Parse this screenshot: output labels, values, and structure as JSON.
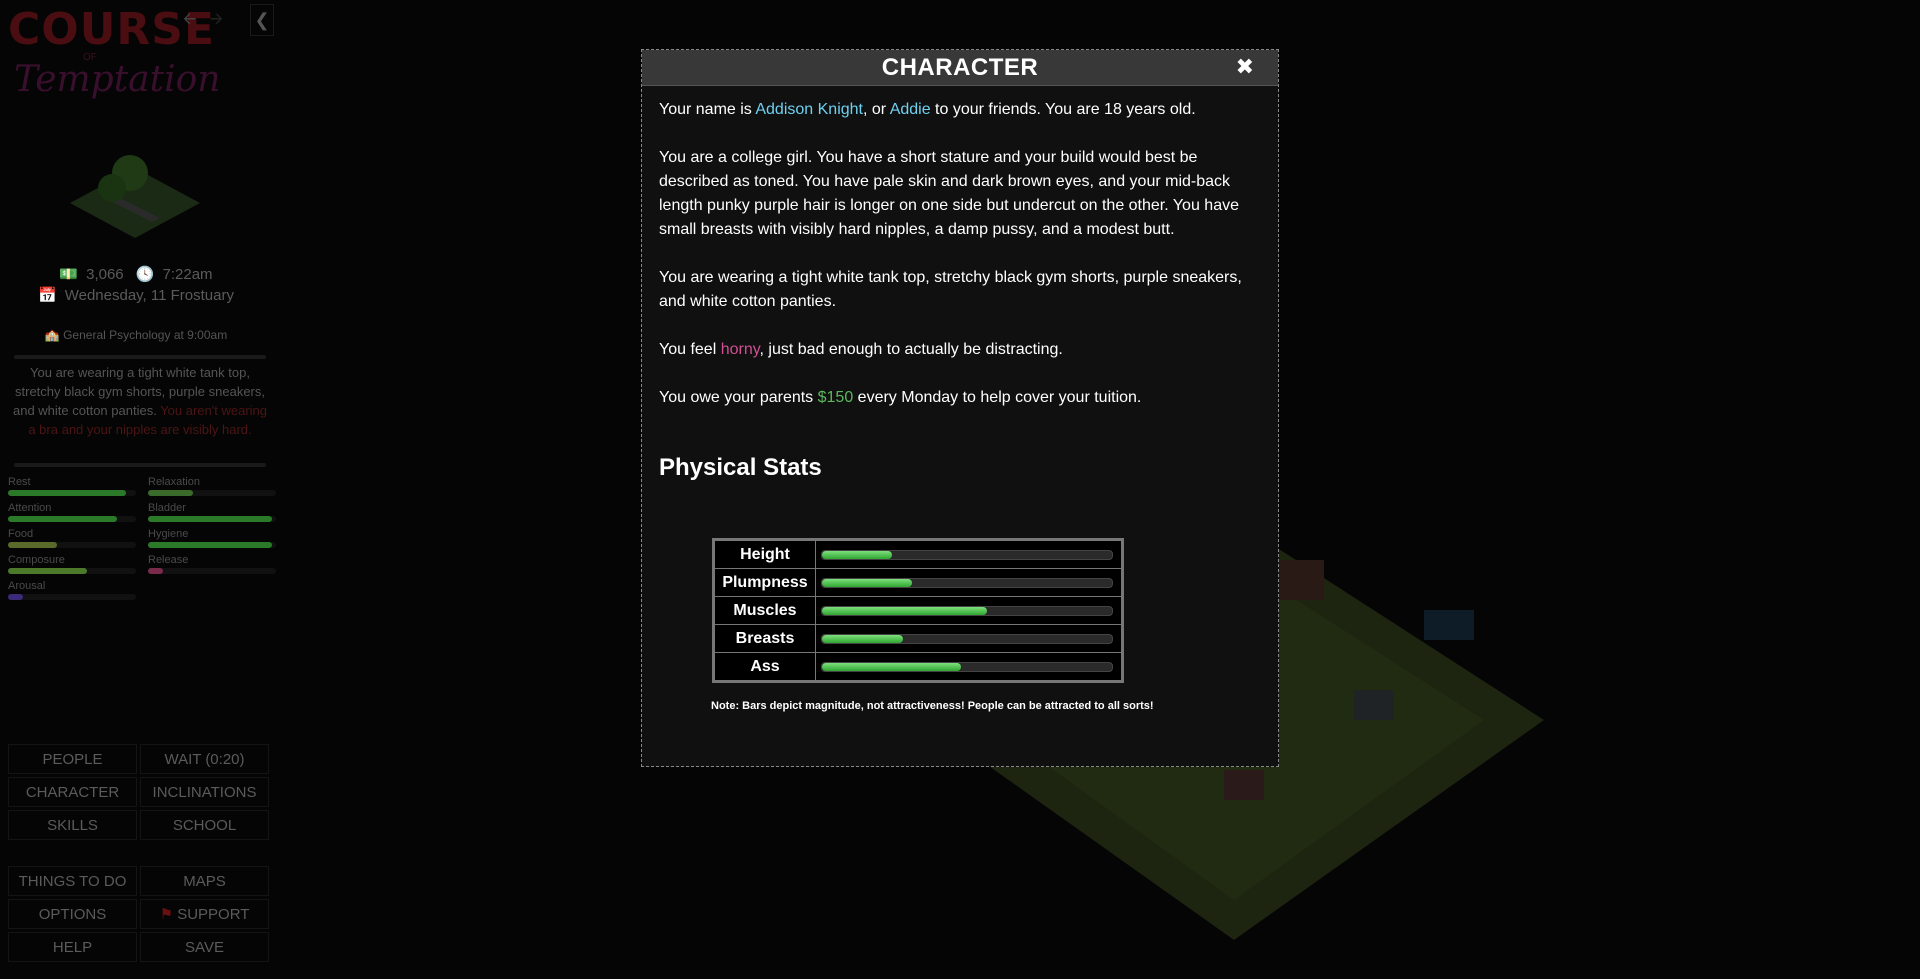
{
  "sidebar": {
    "logo": {
      "line1": "COURSE",
      "line2": "OF",
      "line3": "Temptation"
    },
    "nav": {
      "back_icon": "arrow-left-icon",
      "forward_icon": "arrow-right-icon",
      "collapse_icon": "chevron-left-icon"
    },
    "money": "3,066",
    "time": "7:22am",
    "date": "Wednesday, 11 Frostuary",
    "next_class": "General Psychology at 9:00am",
    "outfit_text": "You are wearing a tight white tank top, stretchy black gym shorts, purple sneakers, and white cotton panties.",
    "outfit_warning": "You aren't wearing a bra and your nipples are visibly hard.",
    "needs": [
      {
        "label": "Rest",
        "level": 0.92,
        "color": "#2a7a2a"
      },
      {
        "label": "Relaxation",
        "level": 0.35,
        "color": "#3b6b2a"
      },
      {
        "label": "Attention",
        "level": 0.85,
        "color": "#2a7a2a"
      },
      {
        "label": "Bladder",
        "level": 0.97,
        "color": "#2a7a2a"
      },
      {
        "label": "Food",
        "level": 0.38,
        "color": "#5a6a2a"
      },
      {
        "label": "Hygiene",
        "level": 0.97,
        "color": "#2a7a2a"
      },
      {
        "label": "Composure",
        "level": 0.62,
        "color": "#4d7a2a"
      },
      {
        "label": "Release",
        "level": 0.12,
        "color": "#7a2a4a"
      },
      {
        "label": "Arousal",
        "level": 0.12,
        "color": "#3b2a7a"
      }
    ],
    "menu1": [
      "PEOPLE",
      "WAIT (0:20)",
      "CHARACTER",
      "INCLINATIONS",
      "SKILLS",
      "SCHOOL"
    ],
    "menu2": [
      "THINGS TO DO",
      "MAPS",
      "OPTIONS",
      "SUPPORT",
      "HELP",
      "SAVE"
    ]
  },
  "modal": {
    "title": "CHARACTER",
    "close_icon": "close-icon",
    "p1": {
      "pre": "Your name is ",
      "fullname": "Addison Knight",
      "mid": ", or ",
      "nickname": "Addie",
      "post": " to your friends. You are 18 years old."
    },
    "p2": "You are a college girl. You have a short stature and your build would best be described as toned. You have pale skin and dark brown eyes, and your mid-back length punky purple hair is longer on one side but undercut on the other. You have small breasts with visibly hard nipples, a damp pussy, and a modest butt.",
    "p3": "You are wearing a tight white tank top, stretchy black gym shorts, purple sneakers, and white cotton panties.",
    "p4": {
      "pre": "You feel ",
      "mood": "horny",
      "post": ", just bad enough to actually be distracting."
    },
    "p5": {
      "pre": "You owe your parents ",
      "amount": "$150",
      "post": " every Monday to help cover your tuition."
    },
    "stats_title": "Physical Stats",
    "stats": [
      {
        "label": "Height",
        "level": 0.24
      },
      {
        "label": "Plumpness",
        "level": 0.31
      },
      {
        "label": "Muscles",
        "level": 0.57
      },
      {
        "label": "Breasts",
        "level": 0.28
      },
      {
        "label": "Ass",
        "level": 0.48
      }
    ],
    "note": "Note: Bars depict magnitude, not attractiveness! People can be attracted to all sorts!"
  }
}
